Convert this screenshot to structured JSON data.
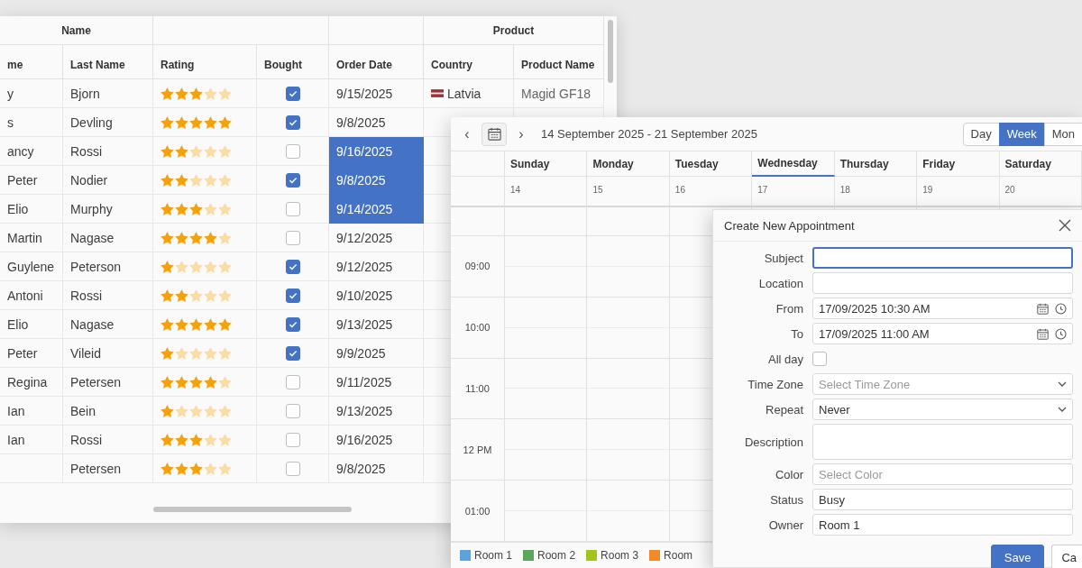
{
  "grid": {
    "column_groups": [
      {
        "label": "Name",
        "columns": [
          {
            "label": "me"
          },
          {
            "label": "Last Name"
          }
        ]
      },
      {
        "columns": [
          {
            "label": "Rating"
          },
          {
            "label": "Bought"
          }
        ]
      },
      {
        "columns": [
          {
            "label": "Order Date"
          }
        ]
      },
      {
        "label": "Product",
        "columns": [
          {
            "label": "Country"
          },
          {
            "label": "Product Name"
          }
        ]
      }
    ],
    "rows": [
      {
        "first_name": "y",
        "last_name": "Bjorn",
        "stars": 3,
        "bought": true,
        "order_date": {
          "text": "9/15/2025",
          "selected": false
        },
        "country": "Latvia",
        "product_name": "Magid GF18"
      },
      {
        "first_name": "s",
        "last_name": "Devling",
        "stars": 5,
        "bought": true,
        "order_date": {
          "text": "9/8/2025",
          "selected": false
        }
      },
      {
        "first_name": "ancy",
        "last_name": "Rossi",
        "stars": 2,
        "bought": false,
        "order_date": {
          "text": "9/16/2025",
          "selected": true
        }
      },
      {
        "first_name": "Peter",
        "last_name": "Nodier",
        "stars": 2,
        "bought": true,
        "order_date": {
          "text": "9/8/2025",
          "selected": true
        }
      },
      {
        "first_name": "Elio",
        "last_name": "Murphy",
        "stars": 3,
        "bought": false,
        "order_date": {
          "text": "9/14/2025",
          "selected": true
        }
      },
      {
        "first_name": "Martin",
        "last_name": "Nagase",
        "stars": 4,
        "bought": false,
        "order_date": {
          "text": "9/12/2025",
          "selected": false
        }
      },
      {
        "first_name": "Guylene",
        "last_name": "Peterson",
        "stars": 1,
        "bought": true,
        "order_date": {
          "text": "9/12/2025",
          "selected": false
        }
      },
      {
        "first_name": "Antoni",
        "last_name": "Rossi",
        "stars": 2,
        "bought": true,
        "order_date": {
          "text": "9/10/2025",
          "selected": false
        }
      },
      {
        "first_name": "Elio",
        "last_name": "Nagase",
        "stars": 5,
        "bought": true,
        "order_date": {
          "text": "9/13/2025",
          "selected": false
        }
      },
      {
        "first_name": "Peter",
        "last_name": "Vileid",
        "stars": 1,
        "bought": true,
        "order_date": {
          "text": "9/9/2025",
          "selected": false
        }
      },
      {
        "first_name": "Regina",
        "last_name": "Petersen",
        "stars": 4,
        "bought": false,
        "order_date": {
          "text": "9/11/2025",
          "selected": false
        }
      },
      {
        "first_name": "Ian",
        "last_name": "Bein",
        "stars": 1,
        "bought": false,
        "order_date": {
          "text": "9/13/2025",
          "selected": false
        }
      },
      {
        "first_name": "Ian",
        "last_name": "Rossi",
        "stars": 3,
        "bought": false,
        "order_date": {
          "text": "9/16/2025",
          "selected": false
        }
      },
      {
        "last_name": "Petersen",
        "stars": 3,
        "bought": false,
        "order_date": {
          "text": "9/8/2025",
          "selected": false
        }
      }
    ]
  },
  "scheduler": {
    "toolbar": {
      "prev": "‹",
      "next": "›",
      "title": "14 September 2025 - 21 September 2025",
      "views": [
        {
          "label": "Day",
          "selected": false
        },
        {
          "label": "Week",
          "selected": true
        },
        {
          "label": "Mon",
          "selected": false
        }
      ]
    },
    "days": [
      {
        "name": "Sunday",
        "date": "14",
        "today": false
      },
      {
        "name": "Monday",
        "date": "15",
        "today": false
      },
      {
        "name": "Tuesday",
        "date": "16",
        "today": false
      },
      {
        "name": "Wednesday",
        "date": "17",
        "today": true
      },
      {
        "name": "Thursday",
        "date": "18",
        "today": false
      },
      {
        "name": "Friday",
        "date": "19",
        "today": false
      },
      {
        "name": "Saturday",
        "date": "20",
        "today": false
      }
    ],
    "time_slots": [
      "09:00",
      "10:00",
      "11:00",
      "12 PM",
      "01:00"
    ],
    "legend": [
      {
        "label": "Room 1",
        "color": "#5ba3dc"
      },
      {
        "label": "Room 2",
        "color": "#5aa65c"
      },
      {
        "label": "Room 3",
        "color": "#a4c41c"
      },
      {
        "label": "Room",
        "color": "#f28a2c"
      }
    ]
  },
  "dialog": {
    "title": "Create New Appointment",
    "fields": [
      {
        "label": "Subject",
        "kind": "text",
        "focused": true
      },
      {
        "label": "Location",
        "kind": "text",
        "focused": false
      },
      {
        "label": "From",
        "kind": "datetime",
        "value": "17/09/2025 10:30 AM",
        "focused": false
      },
      {
        "label": "To",
        "kind": "datetime",
        "value": "17/09/2025 11:00 AM",
        "focused": false
      },
      {
        "label": "All day",
        "kind": "checkbox",
        "checked": false
      },
      {
        "label": "Time Zone",
        "kind": "dropdown",
        "placeholder": "Select Time Zone",
        "focused": false
      },
      {
        "label": "Repeat",
        "kind": "dropdown",
        "value": "Never",
        "focused": false
      },
      {
        "label": "Description",
        "kind": "textarea",
        "focused": false
      },
      {
        "label": "Color",
        "kind": "text",
        "placeholder": "Select Color",
        "focused": false
      },
      {
        "label": "Status",
        "kind": "text",
        "value": "Busy",
        "focused": false
      },
      {
        "label": "Owner",
        "kind": "text",
        "value": "Room 1",
        "focused": false
      }
    ],
    "buttons": [
      {
        "label": "Save",
        "kind": "primary"
      },
      {
        "label": "Ca",
        "kind": "secondary"
      }
    ]
  }
}
